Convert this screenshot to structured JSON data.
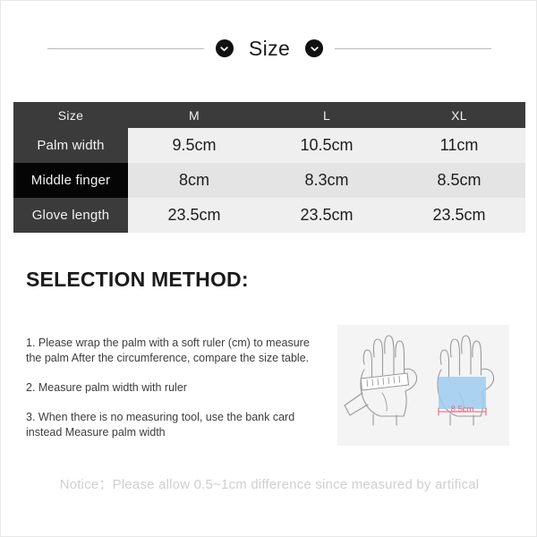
{
  "header": {
    "title": "Size",
    "left_icon": "chevron-down-icon",
    "right_icon": "chevron-down-icon"
  },
  "table": {
    "columns": [
      "Size",
      "M",
      "L",
      "XL"
    ],
    "rows": [
      {
        "label": "Palm width",
        "values": [
          "9.5cm",
          "10.5cm",
          "11cm"
        ]
      },
      {
        "label": "Middle finger",
        "values": [
          "8cm",
          "8.3cm",
          "8.5cm"
        ]
      },
      {
        "label": "Glove length",
        "values": [
          "23.5cm",
          "23.5cm",
          "23.5cm"
        ]
      }
    ]
  },
  "selection": {
    "title": "SELECTION METHOD:",
    "steps": [
      "1. Please wrap the palm with a soft ruler (cm) to measure the palm After the circumference, compare the size table.",
      "2. Measure palm width with ruler",
      "3. When there is no measuring tool, use the bank card instead Measure palm width"
    ]
  },
  "illustration": {
    "left_hand": "hand-with-ruler-illustration",
    "right_hand": "hand-with-measurement-illustration",
    "measure_label": "8.5cm",
    "measure_color": "#f2607a",
    "highlight_color": "#9ecbf0"
  },
  "footer": {
    "notice": "Notice：Please allow 0.5~1cm difference since measured by artifical"
  }
}
